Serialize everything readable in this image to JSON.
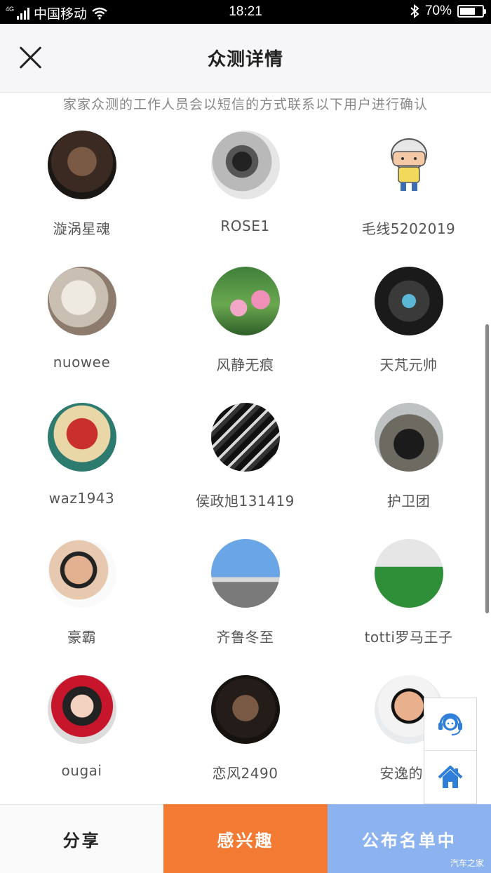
{
  "status_bar": {
    "network": "4G",
    "carrier": "中国移动",
    "time": "18:21",
    "battery": "70%",
    "battery_level": 0.7,
    "icons": [
      "signal-icon",
      "wifi-icon",
      "bluetooth-icon",
      "battery-icon"
    ]
  },
  "header": {
    "title": "众测详情",
    "close_icon": "close-icon"
  },
  "notice": "家家众测的工作人员会以短信的方式联系以下用户进行确认",
  "users": [
    {
      "name": "漩涡星魂"
    },
    {
      "name": "ROSE1"
    },
    {
      "name": "毛线5202019"
    },
    {
      "name": "nuowee"
    },
    {
      "name": "风静无痕"
    },
    {
      "name": "天芃元帅"
    },
    {
      "name": "waz1943"
    },
    {
      "name": "侯政旭131419"
    },
    {
      "name": "护卫团"
    },
    {
      "name": "豪霸"
    },
    {
      "name": "齐鲁冬至"
    },
    {
      "name": "totti罗马王子"
    },
    {
      "name": "ougai"
    },
    {
      "name": "恋风2490"
    },
    {
      "name": "安逸的生"
    }
  ],
  "float_buttons": {
    "support_icon": "customer-service-icon",
    "home_icon": "home-icon"
  },
  "bottom_bar": {
    "share": "分享",
    "interest": "感兴趣",
    "publish": "公布名单中"
  },
  "watermark": "汽车之家",
  "colors": {
    "interest": "#f37a33",
    "publish": "#8cb3f0",
    "icon_blue": "#2f7fd8"
  }
}
